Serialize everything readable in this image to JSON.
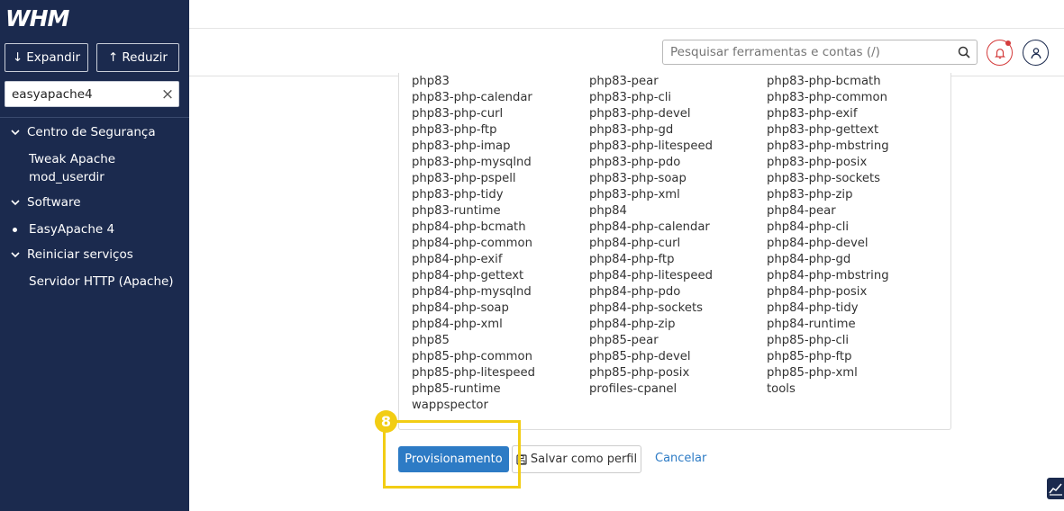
{
  "sidebar": {
    "logo_text": "WHM",
    "expand_label": "Expandir",
    "collapse_label": "Reduzir",
    "search_value": "easyapache4",
    "sections": [
      {
        "label": "Centro de Segurança",
        "items": [
          "Tweak Apache",
          "mod_userdir"
        ]
      },
      {
        "label": "Software",
        "items": [
          "EasyApache 4"
        ]
      },
      {
        "label": "Reiniciar serviços",
        "items": [
          "Servidor HTTP (Apache)"
        ]
      }
    ]
  },
  "header": {
    "search_placeholder": "Pesquisar ferramentas e contas (/)"
  },
  "packages": [
    "php83",
    "php83-pear",
    "php83-php-bcmath",
    "php83-php-calendar",
    "php83-php-cli",
    "php83-php-common",
    "php83-php-curl",
    "php83-php-devel",
    "php83-php-exif",
    "php83-php-ftp",
    "php83-php-gd",
    "php83-php-gettext",
    "php83-php-imap",
    "php83-php-litespeed",
    "php83-php-mbstring",
    "php83-php-mysqlnd",
    "php83-php-pdo",
    "php83-php-posix",
    "php83-php-pspell",
    "php83-php-soap",
    "php83-php-sockets",
    "php83-php-tidy",
    "php83-php-xml",
    "php83-php-zip",
    "php83-runtime",
    "php84",
    "php84-pear",
    "php84-php-bcmath",
    "php84-php-calendar",
    "php84-php-cli",
    "php84-php-common",
    "php84-php-curl",
    "php84-php-devel",
    "php84-php-exif",
    "php84-php-ftp",
    "php84-php-gd",
    "php84-php-gettext",
    "php84-php-litespeed",
    "php84-php-mbstring",
    "php84-php-mysqlnd",
    "php84-php-pdo",
    "php84-php-posix",
    "php84-php-soap",
    "php84-php-sockets",
    "php84-php-tidy",
    "php84-php-xml",
    "php84-php-zip",
    "php84-runtime",
    "php85",
    "php85-pear",
    "php85-php-cli",
    "php85-php-common",
    "php85-php-devel",
    "php85-php-ftp",
    "php85-php-litespeed",
    "php85-php-posix",
    "php85-php-xml",
    "php85-runtime",
    "profiles-cpanel",
    "tools",
    "wappspector"
  ],
  "actions": {
    "provision_label": "Provisionamento",
    "save_label": "Salvar como perfil",
    "cancel_label": "Cancelar"
  },
  "annotation": {
    "step_number": "8",
    "color": "#f2cd14"
  },
  "colors": {
    "sidebar_bg": "#1b2a4e",
    "primary": "#2d7bc5",
    "alert": "#d43c3c"
  }
}
